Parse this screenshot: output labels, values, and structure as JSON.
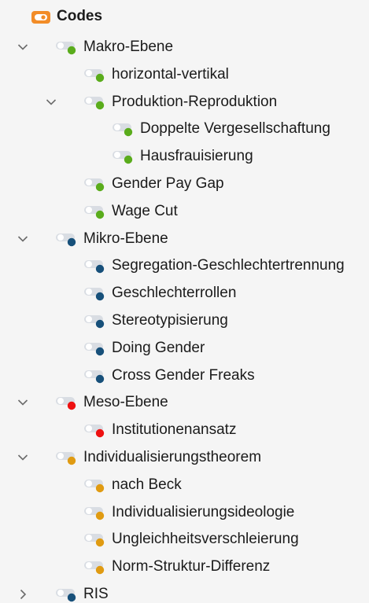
{
  "header": {
    "title": "Codes",
    "icon": "codes-folder-icon",
    "icon_color": "#f28c28"
  },
  "colors": {
    "green": "#5aac1c",
    "blue": "#17507a",
    "red": "#ee1111",
    "orange": "#e09b12",
    "toggle": "#d9dde3",
    "chevron": "#6b6b6b"
  },
  "tree": [
    {
      "key": "makro-ebene",
      "label": "Makro-Ebene",
      "level": 0,
      "expander": "expanded",
      "color": "green"
    },
    {
      "key": "horizontal-vertikal",
      "label": "horizontal-vertikal",
      "level": 1,
      "expander": "none",
      "color": "green"
    },
    {
      "key": "produktion-reproduktion",
      "label": "Produktion-Reproduktion",
      "level": 1,
      "expander": "expanded",
      "color": "green"
    },
    {
      "key": "doppelte-vergesellschaftung",
      "label": "Doppelte Vergesellschaftung",
      "level": 2,
      "expander": "none",
      "color": "green"
    },
    {
      "key": "hausfrauisierung",
      "label": "Hausfrauisierung",
      "level": 2,
      "expander": "none",
      "color": "green"
    },
    {
      "key": "gender-pay-gap",
      "label": "Gender Pay Gap",
      "level": 1,
      "expander": "none",
      "color": "green"
    },
    {
      "key": "wage-cut",
      "label": "Wage Cut",
      "level": 1,
      "expander": "none",
      "color": "green"
    },
    {
      "key": "mikro-ebene",
      "label": "Mikro-Ebene",
      "level": 0,
      "expander": "expanded",
      "color": "blue"
    },
    {
      "key": "segregation-geschlechtertrennung",
      "label": "Segregation-Geschlechtertrennung",
      "level": 1,
      "expander": "none",
      "color": "blue"
    },
    {
      "key": "geschlechterrollen",
      "label": "Geschlechterrollen",
      "level": 1,
      "expander": "none",
      "color": "blue"
    },
    {
      "key": "stereotypisierung",
      "label": "Stereotypisierung",
      "level": 1,
      "expander": "none",
      "color": "blue"
    },
    {
      "key": "doing-gender",
      "label": "Doing Gender",
      "level": 1,
      "expander": "none",
      "color": "blue"
    },
    {
      "key": "cross-gender-freaks",
      "label": "Cross Gender Freaks",
      "level": 1,
      "expander": "none",
      "color": "blue"
    },
    {
      "key": "meso-ebene",
      "label": "Meso-Ebene",
      "level": 0,
      "expander": "expanded",
      "color": "red"
    },
    {
      "key": "institutionenansatz",
      "label": "Institutionenansatz",
      "level": 1,
      "expander": "none",
      "color": "red"
    },
    {
      "key": "individualisierungstheorem",
      "label": "Individualisierungstheorem",
      "level": 0,
      "expander": "expanded",
      "color": "orange"
    },
    {
      "key": "nach-beck",
      "label": "nach Beck",
      "level": 1,
      "expander": "none",
      "color": "orange"
    },
    {
      "key": "individualisierungsideologie",
      "label": "Individualisierungsideologie",
      "level": 1,
      "expander": "none",
      "color": "orange"
    },
    {
      "key": "ungleichheitsverschleierung",
      "label": "Ungleichheitsverschleierung",
      "level": 1,
      "expander": "none",
      "color": "orange"
    },
    {
      "key": "norm-struktur-differenz",
      "label": "Norm-Struktur-Differenz",
      "level": 1,
      "expander": "none",
      "color": "orange"
    },
    {
      "key": "ris",
      "label": "RIS",
      "level": 0,
      "expander": "collapsed",
      "color": "blue"
    }
  ]
}
